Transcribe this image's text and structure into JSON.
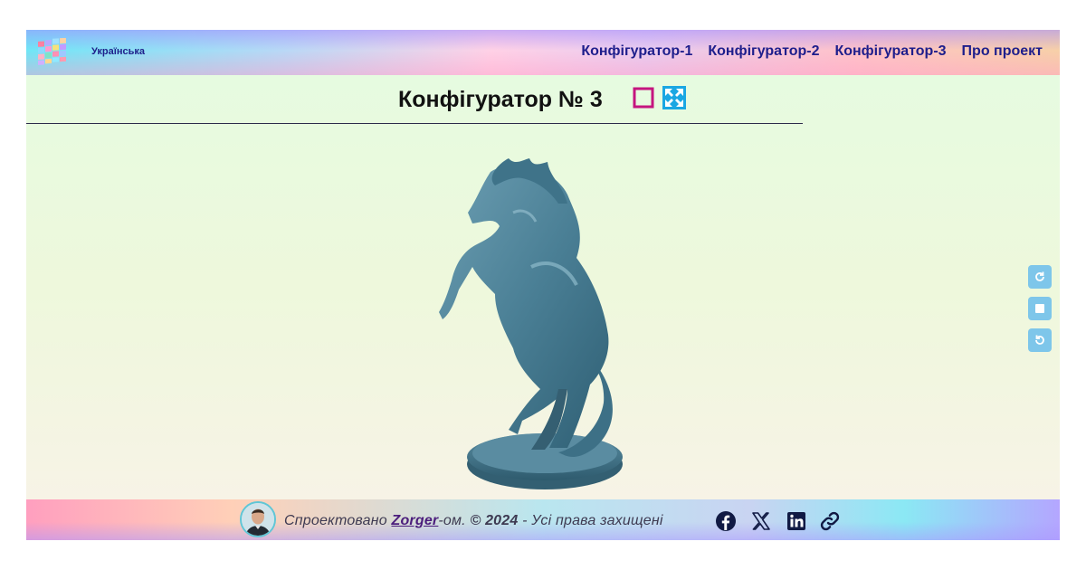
{
  "header": {
    "language": "Українська",
    "nav": [
      {
        "label": "Конфігуратор-1"
      },
      {
        "label": "Конфігуратор-2"
      },
      {
        "label": "Конфігуратор-3"
      },
      {
        "label": "Про проект"
      }
    ]
  },
  "main": {
    "title": "Конфігуратор № 3",
    "title_icons": [
      "fullscreen-frame-icon",
      "expand-arrows-icon"
    ],
    "model_color": "#4a7f95",
    "side_controls": [
      "rotate-clockwise-icon",
      "stop-icon",
      "rotate-counterclockwise-icon"
    ]
  },
  "footer": {
    "prefix": "Спроектовано ",
    "author": "Zorger",
    "suffix": "-ом. ",
    "copyright": "© 2024",
    "rights": " - Усі права захищені",
    "social": [
      "facebook-icon",
      "x-icon",
      "linkedin-icon",
      "link-icon"
    ]
  },
  "colors": {
    "nav_text": "#1e1e8c",
    "accent_magenta": "#c5157f",
    "accent_cyan": "#1aa7e3",
    "side_button": "#7ec6ea"
  }
}
